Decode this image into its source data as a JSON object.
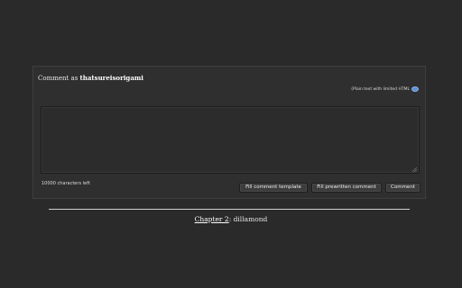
{
  "comment_form": {
    "heading_prefix": "Comment as",
    "username": "thatsureisorigami",
    "html_note": "(Plain text with limited HTML",
    "textarea_value": "",
    "characters_left": "10000 characters left",
    "buttons": {
      "fill_template": "Fill comment template",
      "fill_prewritten": "Fill prewritten comment",
      "comment": "Comment"
    }
  },
  "footer": {
    "chapter_link": "Chapter 2",
    "separator": ":",
    "chapter_title": "dillamond"
  },
  "colors": {
    "background": "#2a2a2a",
    "panel": "#2f2f2f",
    "help_icon": "#5f8fd6"
  },
  "icons": {
    "help": "help-icon"
  }
}
